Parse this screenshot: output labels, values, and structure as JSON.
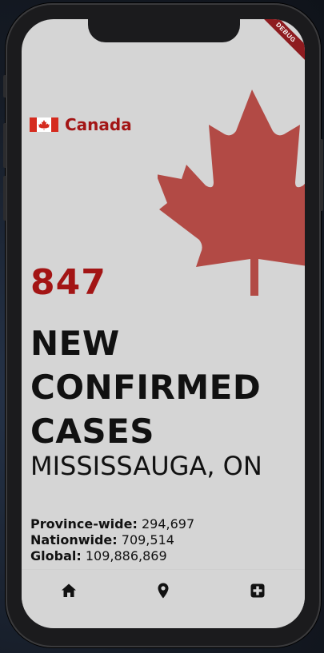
{
  "debug_banner": "DEBUG",
  "header": {
    "country": "Canada",
    "flag_icon": "canada-flag-icon"
  },
  "stats": {
    "new_cases": "847",
    "headline_lines": [
      "NEW",
      "CONFIRMED",
      "CASES"
    ],
    "location": "MISSISSAUGA, ON",
    "province_label": "Province-wide:",
    "province_value": "294,697",
    "nation_label": "Nationwide:",
    "nation_value": "709,514",
    "global_label": "Global:",
    "global_value": "109,886,869"
  },
  "nav": {
    "items": [
      {
        "icon": "home-icon"
      },
      {
        "icon": "location-pin-icon"
      },
      {
        "icon": "medical-plus-icon"
      }
    ]
  },
  "colors": {
    "accent": "#a31515",
    "maple": "#b24a45",
    "background": "#d5d5d5"
  }
}
